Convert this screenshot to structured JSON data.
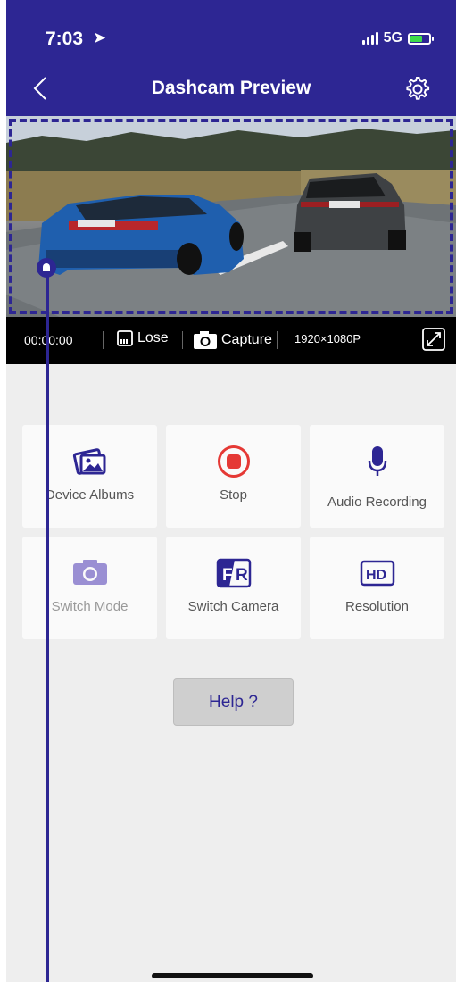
{
  "status": {
    "time": "7:03",
    "network": "5G"
  },
  "header": {
    "title": "Dashcam Preview"
  },
  "controls": {
    "timer": "00:00:00",
    "lose_label": "Lose",
    "capture_label": "Capture",
    "resolution": "1920×1080P"
  },
  "tiles": [
    {
      "label": "Device Albums"
    },
    {
      "label": "Stop"
    },
    {
      "label": "Audio Recording"
    },
    {
      "label": "Switch Mode"
    },
    {
      "label": "Switch Camera"
    },
    {
      "label": "Resolution"
    }
  ],
  "help": {
    "label": "Help ?"
  },
  "colors": {
    "accent": "#2d2693",
    "record": "#e53935"
  }
}
